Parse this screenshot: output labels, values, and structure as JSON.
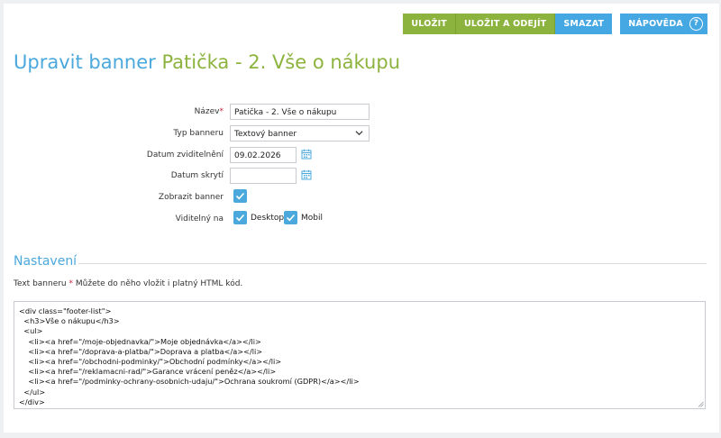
{
  "toolbar": {
    "save": "ULOŽIT",
    "save_leave": "ULOŽIT A ODEJÍT",
    "delete": "SMAZAT",
    "help": "NÁPOVĚDA",
    "help_icon": "?"
  },
  "header": {
    "prefix": "Upravit banner",
    "name": "Patička - 2. Vše o nákupu"
  },
  "form": {
    "name_label": "Název",
    "name_value": "Patička - 2. Vše o nákupu",
    "type_label": "Typ banneru",
    "type_value": "Textový banner",
    "show_date_label": "Datum zviditelnění",
    "show_date_value": "09.02.2026",
    "hide_date_label": "Datum skrytí",
    "hide_date_value": "",
    "display_label": "Zobrazit banner",
    "display_checked": true,
    "visible_label": "Viditelný na",
    "desktop_label": "Desktop",
    "desktop_checked": true,
    "mobile_label": "Mobil",
    "mobile_checked": true,
    "required_mark": "*"
  },
  "settings": {
    "title": "Nastavení",
    "text_label": "Text banneru",
    "required_mark": "*",
    "hint": "Můžete do něho vložit i platný HTML kód.",
    "code_lines": [
      "<div class=\"footer-list\">",
      "  <h3>Vše o nákupu</h3>",
      "  <ul>",
      "    <li><a href=\"/moje-objednavka/\">Moje objednávka</a></li>",
      "    <li><a href=\"/doprava-a-platba/\">Doprava a platba</a></li>",
      "    <li><a href=\"/obchodni-podminky/\">Obchodní podmínky</a></li>",
      "    <li><a href=\"/reklamacni-rad/\">Garance vrácení peněz</a></li>",
      "    <li><a href=\"/podminky-ochrany-osobnich-udaju/\">Ochrana soukromí (GDPR)</a></li>",
      "  </ul>",
      "</div>"
    ]
  },
  "colors": {
    "accent_blue": "#46a8e3",
    "accent_green": "#8db33f",
    "required_red": "#d0243a"
  }
}
